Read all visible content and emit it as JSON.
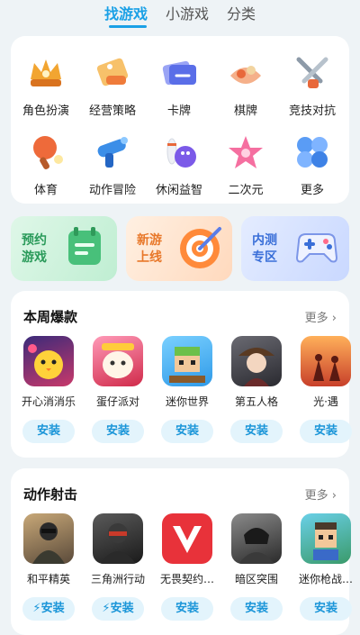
{
  "tabs": [
    {
      "label": "找游戏"
    },
    {
      "label": "小游戏"
    },
    {
      "label": "分类"
    }
  ],
  "categories": [
    {
      "label": "角色扮演",
      "icon": "role-play-icon"
    },
    {
      "label": "经营策略",
      "icon": "strategy-scroll-icon"
    },
    {
      "label": "卡牌",
      "icon": "card-icon"
    },
    {
      "label": "棋牌",
      "icon": "chess-board-icon"
    },
    {
      "label": "竞技对抗",
      "icon": "swords-icon"
    },
    {
      "label": "体育",
      "icon": "ping-pong-icon"
    },
    {
      "label": "动作冒险",
      "icon": "blaster-icon"
    },
    {
      "label": "休闲益智",
      "icon": "bowling-icon"
    },
    {
      "label": "二次元",
      "icon": "star-icon"
    },
    {
      "label": "更多",
      "icon": "more-bubbles-icon"
    }
  ],
  "promos": [
    {
      "line1": "预约",
      "line2": "游戏",
      "color": "#2a9a5a"
    },
    {
      "line1": "新游",
      "line2": "上线",
      "color": "#e8782a"
    },
    {
      "line1": "内测",
      "line2": "专区",
      "color": "#3a6fd8"
    }
  ],
  "weekly": {
    "title": "本周爆款",
    "more": "更多",
    "games": [
      {
        "name": "开心消消乐",
        "install": "安装"
      },
      {
        "name": "蛋仔派对",
        "install": "安装"
      },
      {
        "name": "迷你世界",
        "install": "安装"
      },
      {
        "name": "第五人格",
        "install": "安装"
      },
      {
        "name": "光·遇",
        "install": "安装"
      }
    ]
  },
  "shooter": {
    "title": "动作射击",
    "more": "更多",
    "games": [
      {
        "name": "和平精英",
        "install": "安装",
        "fast": true
      },
      {
        "name": "三角洲行动",
        "install": "安装",
        "fast": true
      },
      {
        "name": "无畏契约…",
        "install": "安装"
      },
      {
        "name": "暗区突围",
        "install": "安装"
      },
      {
        "name": "迷你枪战…",
        "install": "安装"
      }
    ]
  },
  "colors": {
    "accent": "#1aa0e6",
    "install_bg": "#e3f4fc"
  }
}
